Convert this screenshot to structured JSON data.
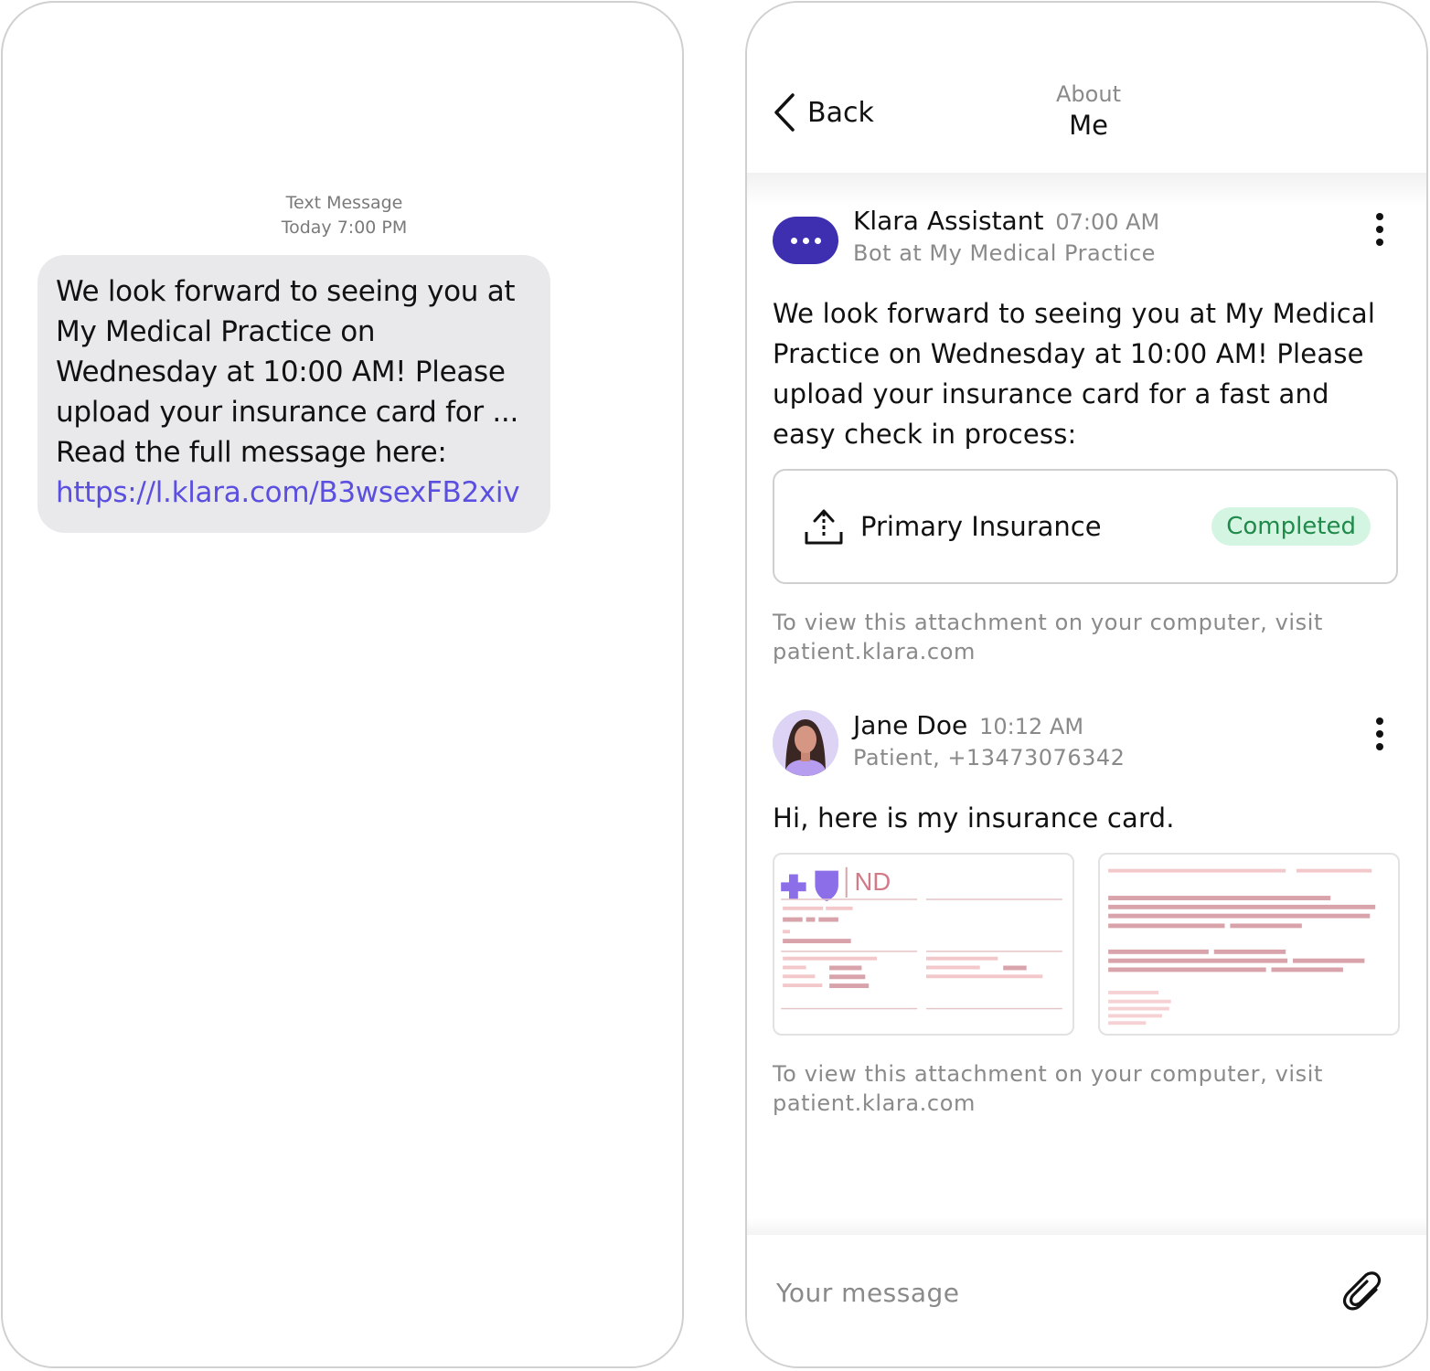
{
  "sms": {
    "meta_label": "Text Message",
    "meta_time": "Today 7:00 PM",
    "bubble_text": "We look forward to seeing you at My Medical Practice on Wednesday at 10:00 AM! Please upload your insurance card for ... Read the full message here:",
    "link": "https://l.klara.com/B3wsexFB2xiv"
  },
  "header": {
    "back_label": "Back",
    "title_sub": "About",
    "title_main": "Me"
  },
  "messages": [
    {
      "sender": "Klara Assistant",
      "time": "07:00 AM",
      "role": "Bot at My Medical Practice",
      "body": "We look forward to seeing you at My Medical Practice on Wednesday at 10:00 AM! Please upload your insurance card for a fast and easy check in process:",
      "attachment": {
        "label": "Primary Insurance",
        "status": "Completed",
        "icon": "upload-icon"
      },
      "note": "To view this attachment on your computer, visit patient.klara.com"
    },
    {
      "sender": "Jane Doe",
      "time": "10:12 AM",
      "role": "Patient, +13473076342",
      "body": "Hi, here is my insurance card.",
      "card_logo_text": "ND",
      "note": "To view this attachment on your computer, visit patient.klara.com"
    }
  ],
  "composer": {
    "placeholder": "Your message",
    "attach_icon": "paperclip-icon"
  },
  "colors": {
    "bot_avatar": "#3d2fb0",
    "link": "#5a4fe0",
    "badge_bg": "#d5f5e3",
    "badge_text": "#1f8a4a",
    "sms_bubble": "#e9e9eb"
  }
}
